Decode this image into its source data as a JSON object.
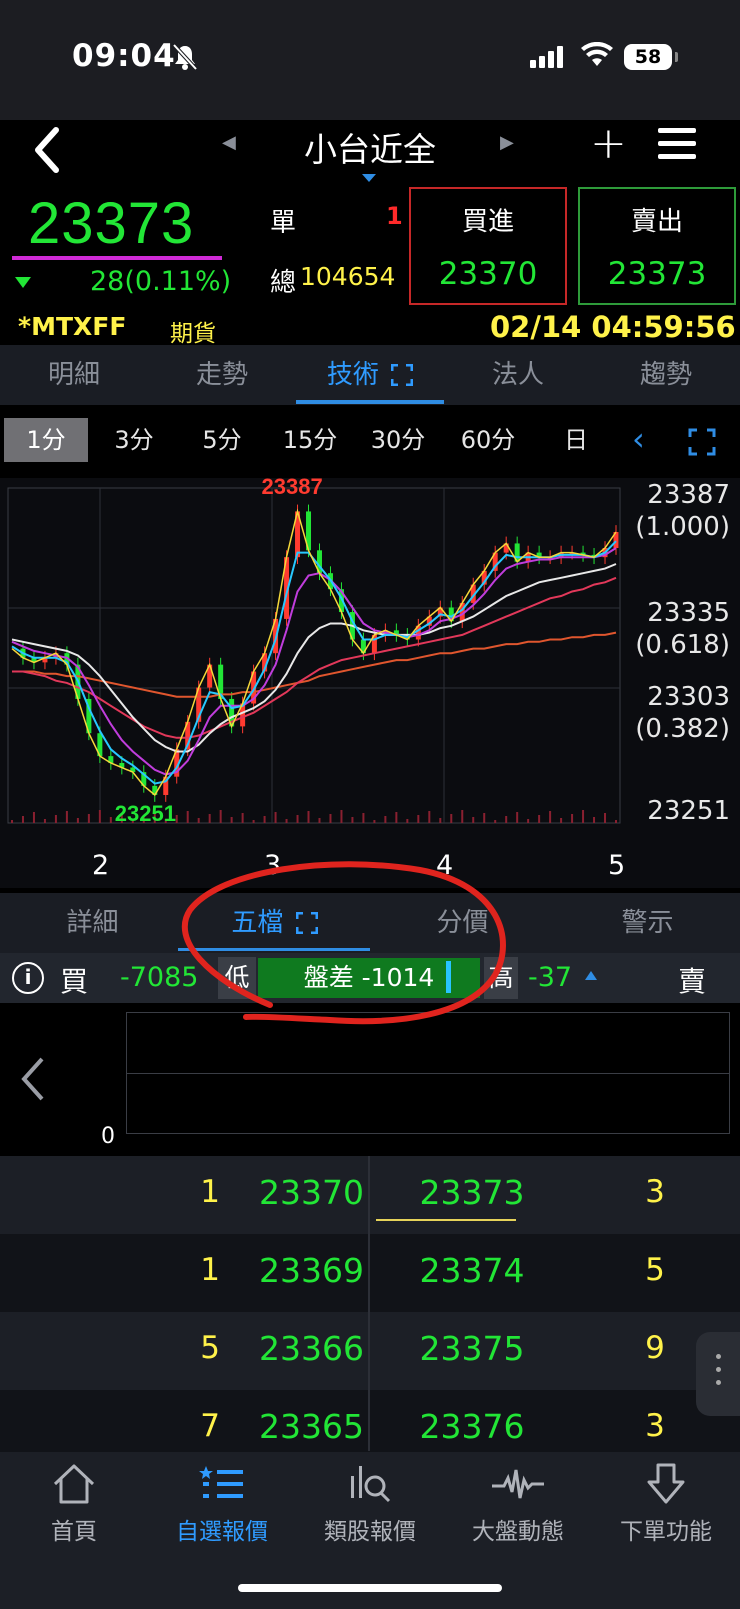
{
  "status_bar": {
    "time": "09:04",
    "battery": "58"
  },
  "nav": {
    "title": "小台近全"
  },
  "quote": {
    "last": "23373",
    "change": "28(0.11%)",
    "dan_label": "單",
    "dan_value": "1",
    "zong_label": "總",
    "zong_value": "104654",
    "buy_label": "買進",
    "buy_value": "23370",
    "sell_label": "賣出",
    "sell_value": "23373",
    "code": "*MTXFF",
    "type": "期貨",
    "datetime": "02/14 04:59:56"
  },
  "tabs": [
    "明細",
    "走勢",
    "技術",
    "法人",
    "趨勢"
  ],
  "intervals": [
    "1分",
    "3分",
    "5分",
    "15分",
    "30分",
    "60分",
    "日"
  ],
  "chart_data": {
    "type": "line",
    "title": "",
    "high_label": "23387",
    "low_label": "23251",
    "y_axis_labels": [
      "23387",
      "(1.000)",
      "23335",
      "(0.618)",
      "23303",
      "(0.382)",
      "23251"
    ],
    "x_ticks": [
      "2",
      "3",
      "4",
      "5"
    ],
    "ylim": [
      23251,
      23387
    ],
    "series": [
      {
        "values": [
          23322,
          23318,
          23316,
          23318,
          23320,
          23315,
          23300,
          23285,
          23275,
          23272,
          23270,
          23268,
          23262,
          23258,
          23266,
          23278,
          23290,
          23305,
          23315,
          23300,
          23288,
          23298,
          23312,
          23320,
          23335,
          23362,
          23382,
          23365,
          23355,
          23348,
          23338,
          23326,
          23320,
          23328,
          23330,
          23328,
          23326,
          23332,
          23336,
          23340,
          23334,
          23342,
          23350,
          23356,
          23364,
          23368,
          23360,
          23364,
          23362,
          23362,
          23364,
          23364,
          23363,
          23362,
          23366,
          23373
        ]
      },
      {
        "values": [
          23323,
          23320,
          23318,
          23318,
          23318,
          23316,
          23308,
          23296,
          23286,
          23278,
          23274,
          23271,
          23267,
          23263,
          23264,
          23270,
          23280,
          23292,
          23303,
          23302,
          23296,
          23297,
          23304,
          23313,
          23326,
          23346,
          23364,
          23364,
          23358,
          23352,
          23344,
          23334,
          23326,
          23326,
          23328,
          23328,
          23327,
          23330,
          23333,
          23337,
          23336,
          23339,
          23345,
          23351,
          23358,
          23363,
          23362,
          23362,
          23362,
          23362,
          23363,
          23363,
          23363,
          23362,
          23364,
          23369
        ]
      },
      {
        "values": [
          23325,
          23323,
          23321,
          23320,
          23319,
          23318,
          23314,
          23306,
          23297,
          23289,
          23282,
          23277,
          23273,
          23269,
          23267,
          23268,
          23273,
          23282,
          23292,
          23297,
          23297,
          23297,
          23300,
          23306,
          23315,
          23330,
          23347,
          23354,
          23355,
          23352,
          23347,
          23340,
          23333,
          23330,
          23329,
          23328,
          23327,
          23328,
          23330,
          23334,
          23335,
          23337,
          23341,
          23346,
          23352,
          23357,
          23359,
          23360,
          23361,
          23361,
          23362,
          23362,
          23362,
          23362,
          23363,
          23366
        ]
      },
      {
        "values": [
          23326,
          23325,
          23324,
          23323,
          23322,
          23321,
          23319,
          23315,
          23310,
          23304,
          23298,
          23292,
          23287,
          23282,
          23279,
          23277,
          23277,
          23280,
          23285,
          23289,
          23292,
          23294,
          23296,
          23299,
          23304,
          23311,
          23320,
          23327,
          23331,
          23333,
          23333,
          23332,
          23330,
          23329,
          23328,
          23328,
          23328,
          23328,
          23329,
          23331,
          23332,
          23334,
          23336,
          23339,
          23342,
          23345,
          23347,
          23349,
          23351,
          23352,
          23353,
          23354,
          23355,
          23356,
          23357,
          23359
        ]
      },
      {
        "values": [
          23312,
          23312,
          23311,
          23310,
          23308,
          23307,
          23305,
          23303,
          23300,
          23297,
          23294,
          23291,
          23288,
          23286,
          23284,
          23283,
          23283,
          23284,
          23286,
          23288,
          23290,
          23292,
          23294,
          23297,
          23300,
          23303,
          23307,
          23310,
          23313,
          23315,
          23317,
          23318,
          23319,
          23320,
          23321,
          23322,
          23323,
          23324,
          23325,
          23326,
          23327,
          23328,
          23330,
          23332,
          23334,
          23336,
          23338,
          23340,
          23342,
          23344,
          23345,
          23347,
          23348,
          23350,
          23351,
          23353
        ]
      },
      {
        "values": [
          23312,
          23312,
          23312,
          23311,
          23311,
          23310,
          23310,
          23309,
          23308,
          23307,
          23306,
          23305,
          23304,
          23303,
          23302,
          23301,
          23301,
          23301,
          23301,
          23302,
          23302,
          23303,
          23303,
          23304,
          23305,
          23306,
          23307,
          23308,
          23310,
          23311,
          23312,
          23313,
          23314,
          23315,
          23316,
          23317,
          23317,
          23318,
          23319,
          23320,
          23320,
          23321,
          23322,
          23322,
          23323,
          23324,
          23324,
          23325,
          23325,
          23326,
          23326,
          23327,
          23327,
          23328,
          23328,
          23329
        ]
      }
    ],
    "series_colors": [
      "#f5d83a",
      "#28c8ff",
      "#c03ddc",
      "#e8e8e8",
      "#e2385a",
      "#e0562e"
    ]
  },
  "subtabs": [
    "詳細",
    "五檔",
    "分價",
    "警示"
  ],
  "spread": {
    "buy_label": "買",
    "buy_value": "-7085",
    "low_label": "低",
    "diff_text": "盤差 -1014",
    "high_label": "高",
    "high_value": "-37",
    "sell_label": "賣"
  },
  "depth": {
    "zero": "0"
  },
  "orderbook": [
    {
      "bid_qty": "1",
      "bid": "23370",
      "ask": "23373",
      "ask_qty": "3"
    },
    {
      "bid_qty": "1",
      "bid": "23369",
      "ask": "23374",
      "ask_qty": "5"
    },
    {
      "bid_qty": "5",
      "bid": "23366",
      "ask": "23375",
      "ask_qty": "9"
    },
    {
      "bid_qty": "7",
      "bid": "23365",
      "ask": "23376",
      "ask_qty": "3"
    }
  ],
  "bottom_nav": [
    {
      "label": "首頁",
      "icon": "home-icon"
    },
    {
      "label": "自選報價",
      "icon": "list-icon"
    },
    {
      "label": "類股報價",
      "icon": "chart-search-icon"
    },
    {
      "label": "大盤動態",
      "icon": "pulse-icon"
    },
    {
      "label": "下單功能",
      "icon": "order-icon"
    }
  ],
  "colors": {
    "up_green": "#22e636",
    "accent_blue": "#2f8de4",
    "yellow": "#fff24a",
    "red": "#ff2a2a"
  }
}
